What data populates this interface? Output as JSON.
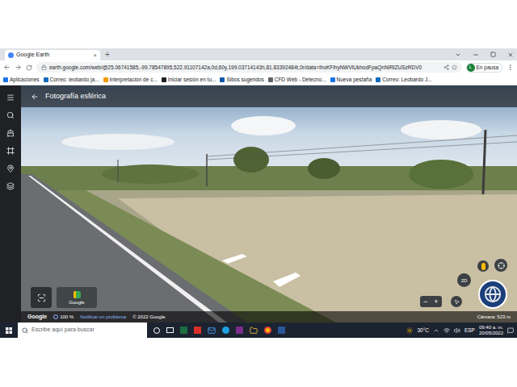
{
  "browser": {
    "tab": {
      "title": "Google Earth",
      "close": "×"
    },
    "new_tab": "+",
    "address": "earth.google.com/web/@25.06741585,-99.78547895,522.91107142a,0d,60y,199.03714143h,81.83392484t,0r/data=IhoKFlhyNWVlUkhodFpaQnNIRlZUSzRDV0",
    "profile": {
      "initial": "L",
      "label": "En pausa"
    },
    "bookmarks": [
      {
        "label": "Aplicaciones",
        "color": "#1a73e8"
      },
      {
        "label": "Correo: leobardo ja...",
        "color": "#0f6cbd"
      },
      {
        "label": "Interpretación de c...",
        "color": "#f29900"
      },
      {
        "label": "Iniciar sesión en tu...",
        "color": "#202124"
      },
      {
        "label": "Sibos sugeridos",
        "color": "#0b57a8"
      },
      {
        "label": "CFD Web - Detecno...",
        "color": "#5f6368"
      },
      {
        "label": "Nueva pestaña",
        "color": "#1a73e8"
      },
      {
        "label": "Correo: Leobardo J...",
        "color": "#0f6cbd"
      }
    ]
  },
  "earth": {
    "header": "Fotografía esférica",
    "logo_button": "Google",
    "mode_button": "2D",
    "zoom": {
      "out": "−",
      "in": "+"
    },
    "footer": {
      "logo": "Google",
      "scale": "100 %",
      "report": "Notificar un problema",
      "copyright": "© 2022 Google",
      "camera": "Cámara: 523 m"
    }
  },
  "taskbar": {
    "search_placeholder": "Escribe aquí para buscar",
    "weather": "30°C",
    "language": "ESP",
    "time": "09:40 a. m.",
    "date": "20/05/2022"
  }
}
